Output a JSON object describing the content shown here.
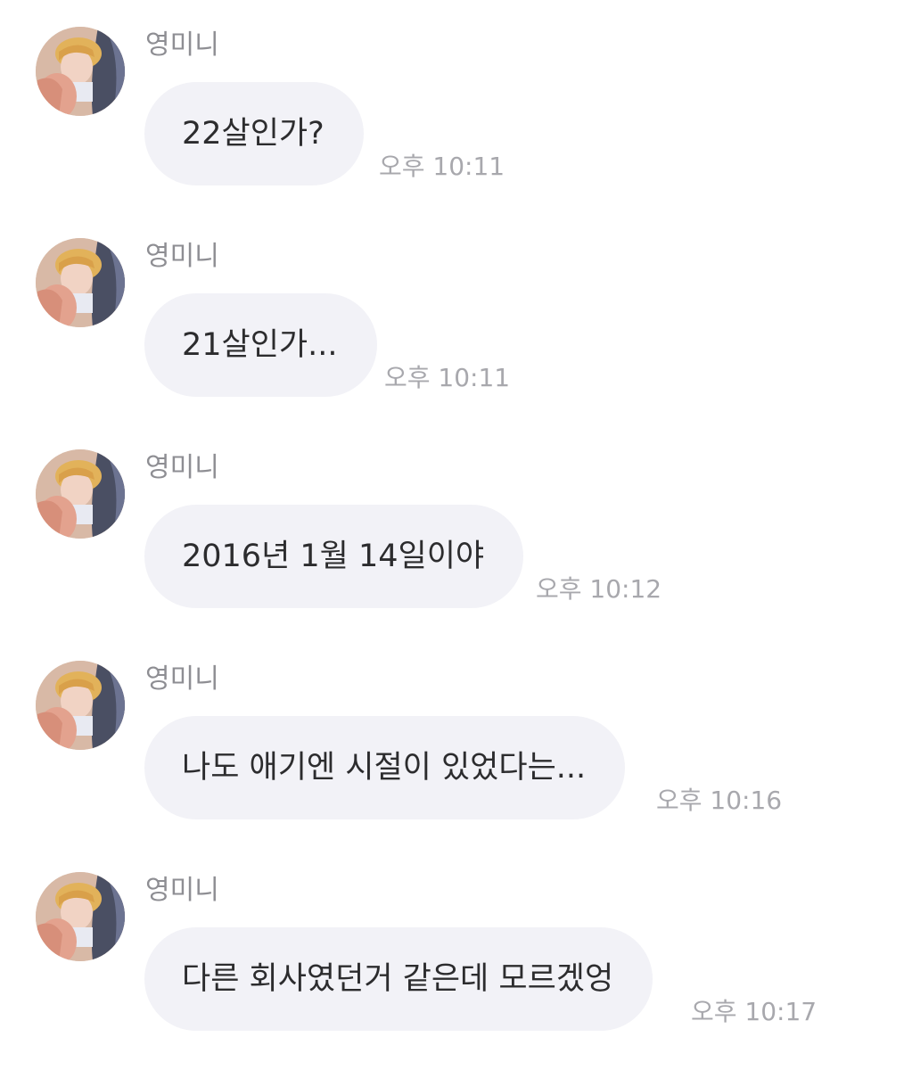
{
  "chat": {
    "messages": [
      {
        "sender": "영미니",
        "text": "22살인가?",
        "time": "오후 10:11",
        "avatar_icon": "profile-photo-icon"
      },
      {
        "sender": "영미니",
        "text": "21살인가...",
        "time": "오후 10:11",
        "avatar_icon": "profile-photo-icon"
      },
      {
        "sender": "영미니",
        "text": "2016년 1월 14일이야",
        "time": "오후 10:12",
        "avatar_icon": "profile-photo-icon"
      },
      {
        "sender": "영미니",
        "text": "나도 애기엔 시절이 있었다는...",
        "time": "오후 10:16",
        "avatar_icon": "profile-photo-icon"
      },
      {
        "sender": "영미니",
        "text": "다른 회사였던거 같은데 모르겠엉",
        "time": "오후 10:17",
        "avatar_icon": "profile-photo-icon"
      }
    ]
  },
  "colors": {
    "bubble_background": "#f2f2f7",
    "message_text": "#2c2c2e",
    "sender_name": "#8e8e93",
    "timestamp": "#a8a8ad"
  }
}
